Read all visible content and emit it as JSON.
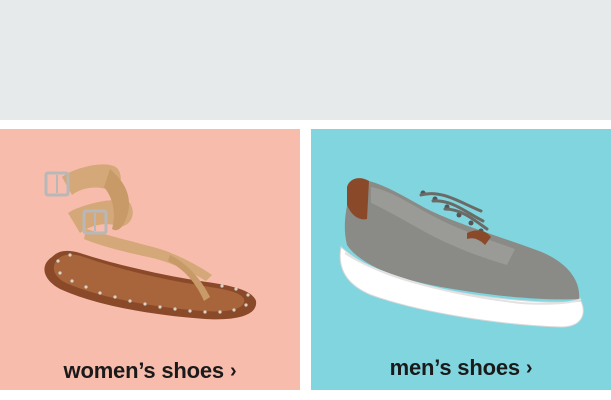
{
  "banner": {},
  "tiles": [
    {
      "id": "women",
      "label": "women’s shoes",
      "chevron": "›",
      "bg_color": "#f7bcac",
      "icon": "sandal-image"
    },
    {
      "id": "men",
      "label": "men’s shoes",
      "chevron": "›",
      "bg_color": "#80d5df",
      "icon": "sneaker-image"
    }
  ],
  "colors": {
    "banner_bg": "#e6eaea",
    "text": "#1a1a1a"
  }
}
